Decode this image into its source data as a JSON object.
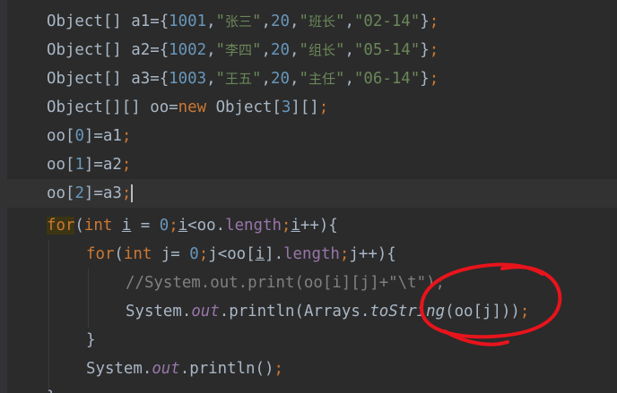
{
  "lines": [
    {
      "text": "Object[] a1={1001,\"张三\",20,\"班长\",\"02-14\"};"
    },
    {
      "text": "Object[] a2={1002,\"李四\",20,\"组长\",\"05-14\"};"
    },
    {
      "text": "Object[] a3={1003,\"王五\",20,\"主任\",\"06-14\"};"
    },
    {
      "text": "Object[][] oo=new Object[3][];"
    },
    {
      "text": "oo[0]=a1;"
    },
    {
      "text": "oo[1]=a2;"
    },
    {
      "text": "oo[2]=a3;"
    },
    {
      "text": "for(int i = 0;i<oo.length;i++){"
    },
    {
      "text": "for(int j= 0;j<oo[i].length;j++){"
    },
    {
      "text": "//System.out.print(oo[i][j]+\"\\t\");"
    },
    {
      "text": "System.out.println(Arrays.toString(oo[j]));"
    },
    {
      "text": "}"
    },
    {
      "text": "System.out.println();"
    },
    {
      "text": "}"
    }
  ],
  "tokens": {
    "object": "Object",
    "brackets": "[]",
    "a1": "a1",
    "a2": "a2",
    "a3": "a3",
    "eq_brace": "={",
    "id1": "1001",
    "id2": "1002",
    "id3": "1003",
    "n1": "张三",
    "n2": "李四",
    "n3": "王五",
    "age": "20",
    "r1": "班长",
    "r2": "组长",
    "r3": "主任",
    "d1": "02-14",
    "d2": "05-14",
    "d3": "06-14",
    "oo": "oo",
    "new": "new",
    "three": "3",
    "zero": "0",
    "one": "1",
    "two": "2",
    "for": "for",
    "int": "int",
    "i": "i",
    "j": "j",
    "length": "length",
    "comment": "//System.out.print(oo[i][j]+\"\\t\");",
    "system": "System",
    "out": "out",
    "println": "println",
    "arrays": "Arrays",
    "tostring": "toString"
  },
  "colors": {
    "background": "#2b2b2b",
    "keyword": "#cc7832",
    "string": "#6a8759",
    "number": "#6897bb",
    "field": "#9876aa",
    "comment": "#808080",
    "annotation": "#e8141c"
  }
}
